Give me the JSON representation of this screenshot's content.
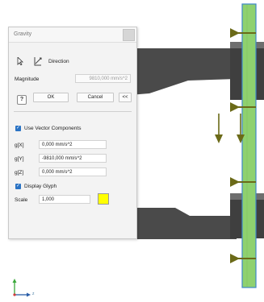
{
  "dialog": {
    "title": "Gravity",
    "direction_label": "Direction",
    "magnitude_label": "Magnitude",
    "magnitude_value": "9810,000 mm/s^2",
    "help_label": "?",
    "ok_label": "OK",
    "cancel_label": "Cancel",
    "collapse_label": "<<",
    "use_vector_label": "Use Vector Components",
    "use_vector_checked": true,
    "gx_label": "g[X]",
    "gx_value": "0,000 mm/s^2",
    "gy_label": "g[Y]",
    "gy_value": "-9810,000 mm/s^2",
    "gz_label": "g[Z]",
    "gz_value": "0,000 mm/s^2",
    "display_glyph_label": "Display Glyph",
    "display_glyph_checked": true,
    "scale_label": "Scale",
    "scale_value": "1,000",
    "glyph_color": "#ffff00"
  },
  "triad": {
    "z_label": "z"
  },
  "colors": {
    "part": "#4a4a4a",
    "beam_fill": "#8fd16f",
    "beam_stroke": "#3d87c9",
    "arrow": "#6b6a18",
    "checkbox": "#2a73c4"
  }
}
